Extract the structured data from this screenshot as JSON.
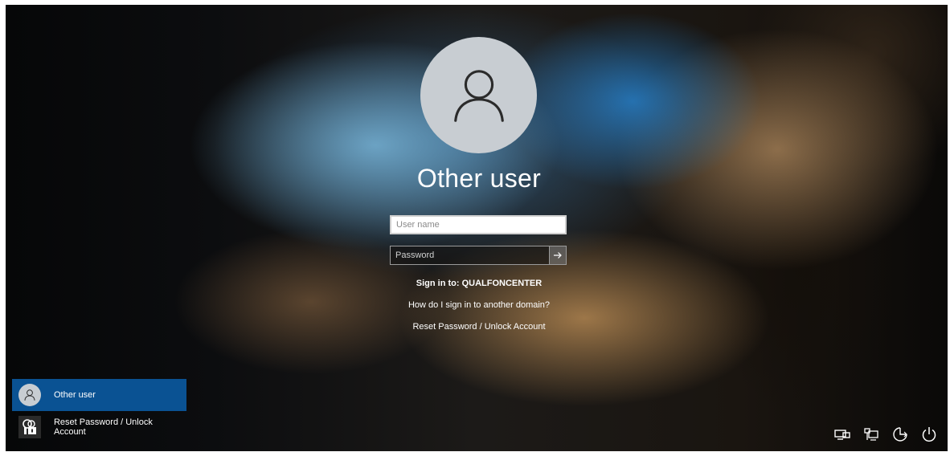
{
  "login": {
    "title": "Other user",
    "username_placeholder": "User name",
    "password_placeholder": "Password",
    "sign_in_to": "Sign in to: QUALFONCENTER",
    "domain_help_link": "How do I sign in to another domain?",
    "reset_link": "Reset Password / Unlock Account"
  },
  "user_list": [
    {
      "label": "Other user",
      "icon": "user-avatar-icon",
      "selected": true
    },
    {
      "label": "Reset Password / Unlock Account",
      "icon": "lock-keys-icon",
      "selected": false
    }
  ],
  "tray_icons": [
    "network-icon",
    "ethernet-icon",
    "ease-of-access-icon",
    "power-icon"
  ],
  "colors": {
    "selected_tile": "#0a5293",
    "avatar_bg": "#c8cdd2",
    "text": "#ffffff"
  }
}
